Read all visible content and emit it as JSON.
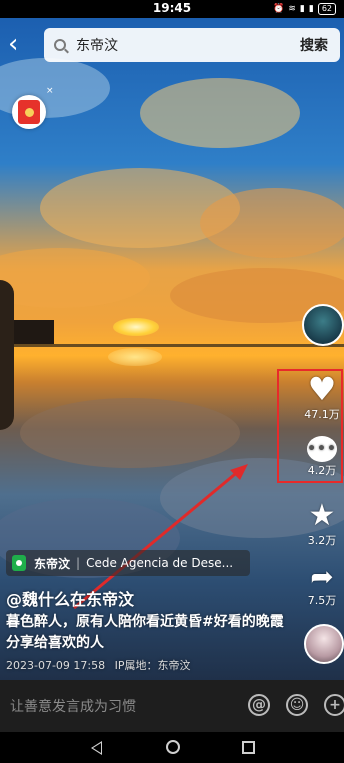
{
  "status": {
    "time": "19:45",
    "icons": [
      "alarm-icon",
      "wifi-icon",
      "5g-signal-icon",
      "4g-signal-icon"
    ],
    "battery": "62"
  },
  "search": {
    "query": "东帝汶",
    "button": "搜索"
  },
  "actions": {
    "likes": "47.1万",
    "comments": "4.2万",
    "favorites": "3.2万",
    "shares": "7.5万"
  },
  "post": {
    "location": "东帝汶",
    "location_sub": "Cede Agencia de Dese...",
    "author": "@魏什么在东帝汶",
    "description": "暮色醉人，原有人陪你看近黄昏#好看的晚霞分享给喜欢的人",
    "date": "2023-07-09 17:58",
    "ip": "IP属地：东帝汶"
  },
  "comment_bar": {
    "placeholder": "让善意发言成为习惯"
  },
  "colors": {
    "highlight": "#e82a2a",
    "location_pin": "#1fae4b"
  }
}
